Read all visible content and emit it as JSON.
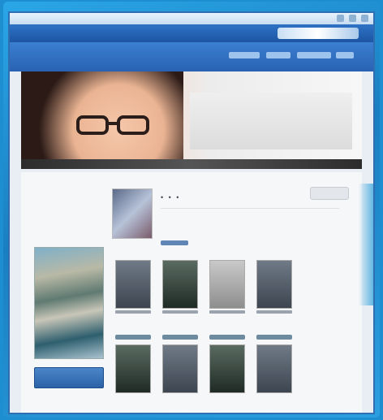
{
  "window": {
    "title": ""
  },
  "profile": {
    "name": "• • •"
  },
  "sidebar": {
    "button_label": ""
  },
  "icons": {
    "close": "close-icon",
    "minimize": "minimize-icon",
    "maximize": "maximize-icon"
  },
  "colors": {
    "accent": "#2a62b3",
    "background": "#1d8fd0"
  }
}
